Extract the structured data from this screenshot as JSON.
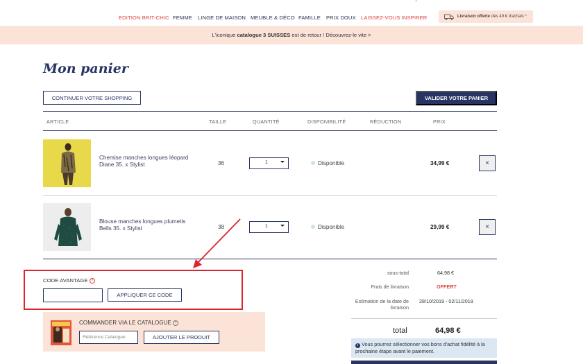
{
  "nav": {
    "catalog_tip": "catalogue",
    "items": [
      {
        "label": "EDITION BRIT-CHIC",
        "red": true
      },
      {
        "label": "FEMME",
        "red": false
      },
      {
        "label": "LINGE DE MAISON",
        "red": false
      },
      {
        "label": "MEUBLE & DÉCO",
        "red": false
      },
      {
        "label": "FAMILLE",
        "red": false
      },
      {
        "label": "PRIX DOUX",
        "red": false
      },
      {
        "label": "LAISSEZ-VOUS INSPIRER",
        "red": true
      }
    ],
    "delivery_bold": "Livraison offerte",
    "delivery_rest": "dès 49 € d'achats *"
  },
  "promo": {
    "prefix": "L'iconique",
    "bold": "catalogue 3 SUISSES",
    "suffix": "est de retour ! Découvrez-le vite >"
  },
  "page_title": "Mon panier",
  "buttons": {
    "continue": "CONTINUER VOTRE SHOPPING",
    "validate": "VALIDER VOTRE PANIER",
    "apply_code": "APPLIQUER CE CODE",
    "add_product": "AJOUTER LE PRODUIT"
  },
  "table_headers": {
    "article": "ARTICLE",
    "taille": "TAILLE",
    "quantite": "QUANTITÉ",
    "disponibilite": "DISPONIBILITÉ",
    "reduction": "RÉDUCTION",
    "prix": "PRIX"
  },
  "items": [
    {
      "name": "Chemise manches longues léopard Diane 35. x Stylist",
      "size": "36",
      "qty": "1",
      "availability": "Disponible",
      "price": "34,99 €"
    },
    {
      "name": "Blouse manches longues plumetis Bells 35. x Stylist",
      "size": "38",
      "qty": "1",
      "availability": "Disponible",
      "price": "29,99 €"
    }
  ],
  "remove_glyph": "×",
  "promo_code": {
    "label": "CODE AVANTAGE",
    "value": ""
  },
  "catalog_order": {
    "label": "COMMANDER VIA LE CATALOGUE",
    "placeholder": "Référence Catalogue"
  },
  "summary": {
    "subtotal_label": "sous-total",
    "subtotal_value": "64,98 €",
    "shipping_label": "Frais de livraison",
    "shipping_value": "OFFERT",
    "estimate_label": "Estimation de la date de livraison",
    "estimate_value": "28/10/2019 - 02/11/2019",
    "total_label": "total",
    "total_value": "64,98 €",
    "note": "Vous pourrez sélectionner vos bons d'achat fidélité à la prochaine étape avant le paiement."
  },
  "colors": {
    "navy": "#283463",
    "accent_red": "#d9453d",
    "peach": "#fbe3d8",
    "annotation_red": "#d9262e"
  },
  "icons": [
    "truck-icon",
    "info-icon",
    "close-icon",
    "chevron-down-icon",
    "arrow-annotation"
  ]
}
